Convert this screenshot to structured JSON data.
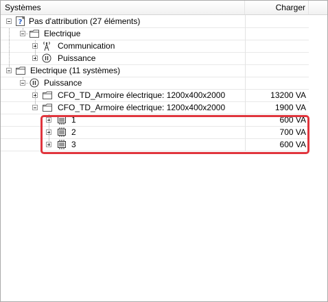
{
  "header": {
    "col_systems": "Systèmes",
    "col_load": "Charger"
  },
  "rows": [
    {
      "label": "Pas d'attribution (27 éléments)",
      "value": "",
      "icon": "unassigned-icon"
    },
    {
      "label": "Electrique",
      "value": "",
      "icon": "folder-icon"
    },
    {
      "label": "Communication",
      "value": "",
      "icon": "communication-icon"
    },
    {
      "label": "Puissance",
      "value": "",
      "icon": "power-icon"
    },
    {
      "label": "Electrique (11 systèmes)",
      "value": "",
      "icon": "folder-icon"
    },
    {
      "label": "Puissance",
      "value": "",
      "icon": "power-icon"
    },
    {
      "label": "CFO_TD_Armoire électrique: 1200x400x2000",
      "value": "13200 VA",
      "icon": "panel-icon"
    },
    {
      "label": "CFO_TD_Armoire électrique: 1200x400x2000",
      "value": "1900 VA",
      "icon": "panel-icon"
    },
    {
      "label": "1",
      "value": "600 VA",
      "icon": "circuit-icon"
    },
    {
      "label": "2",
      "value": "700 VA",
      "icon": "circuit-icon"
    },
    {
      "label": "3",
      "value": "600 VA",
      "icon": "circuit-icon"
    }
  ]
}
